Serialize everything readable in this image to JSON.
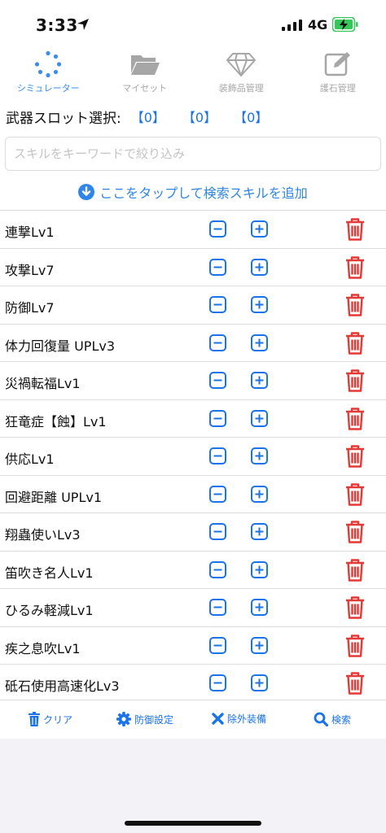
{
  "status_bar": {
    "time": "3:33",
    "network": "4G"
  },
  "tabs": [
    {
      "label": "シミュレーター",
      "icon": "loading-spinner-icon",
      "active": true
    },
    {
      "label": "マイセット",
      "icon": "folder-icon",
      "active": false
    },
    {
      "label": "装飾品管理",
      "icon": "diamond-icon",
      "active": false
    },
    {
      "label": "護石管理",
      "icon": "edit-icon",
      "active": false
    }
  ],
  "weapon_slots": {
    "label": "武器スロット選択:",
    "slots": [
      "【0】",
      "【0】",
      "【0】"
    ]
  },
  "search": {
    "placeholder": "スキルをキーワードで絞り込み",
    "value": ""
  },
  "add_skill_label": "ここをタップして検索スキルを追加",
  "skills": [
    "連撃Lv1",
    "攻撃Lv7",
    "防御Lv7",
    "体力回復量 UPLv3",
    "災禍転福Lv1",
    "狂竜症【蝕】Lv1",
    "供応Lv1",
    "回避距離 UPLv1",
    "翔蟲使いLv3",
    "笛吹き名人Lv1",
    "ひるみ軽減Lv1",
    "疾之息吹Lv1",
    "砥石使用高速化Lv3"
  ],
  "toolbar": {
    "clear_label": "クリア",
    "defense_label": "防御設定",
    "exclude_label": "除外装備",
    "search_label": "検索"
  },
  "colors": {
    "accent": "#1a73e8",
    "delete": "#e53935",
    "inactive": "#a6a6a6",
    "battery": "#34c759"
  }
}
